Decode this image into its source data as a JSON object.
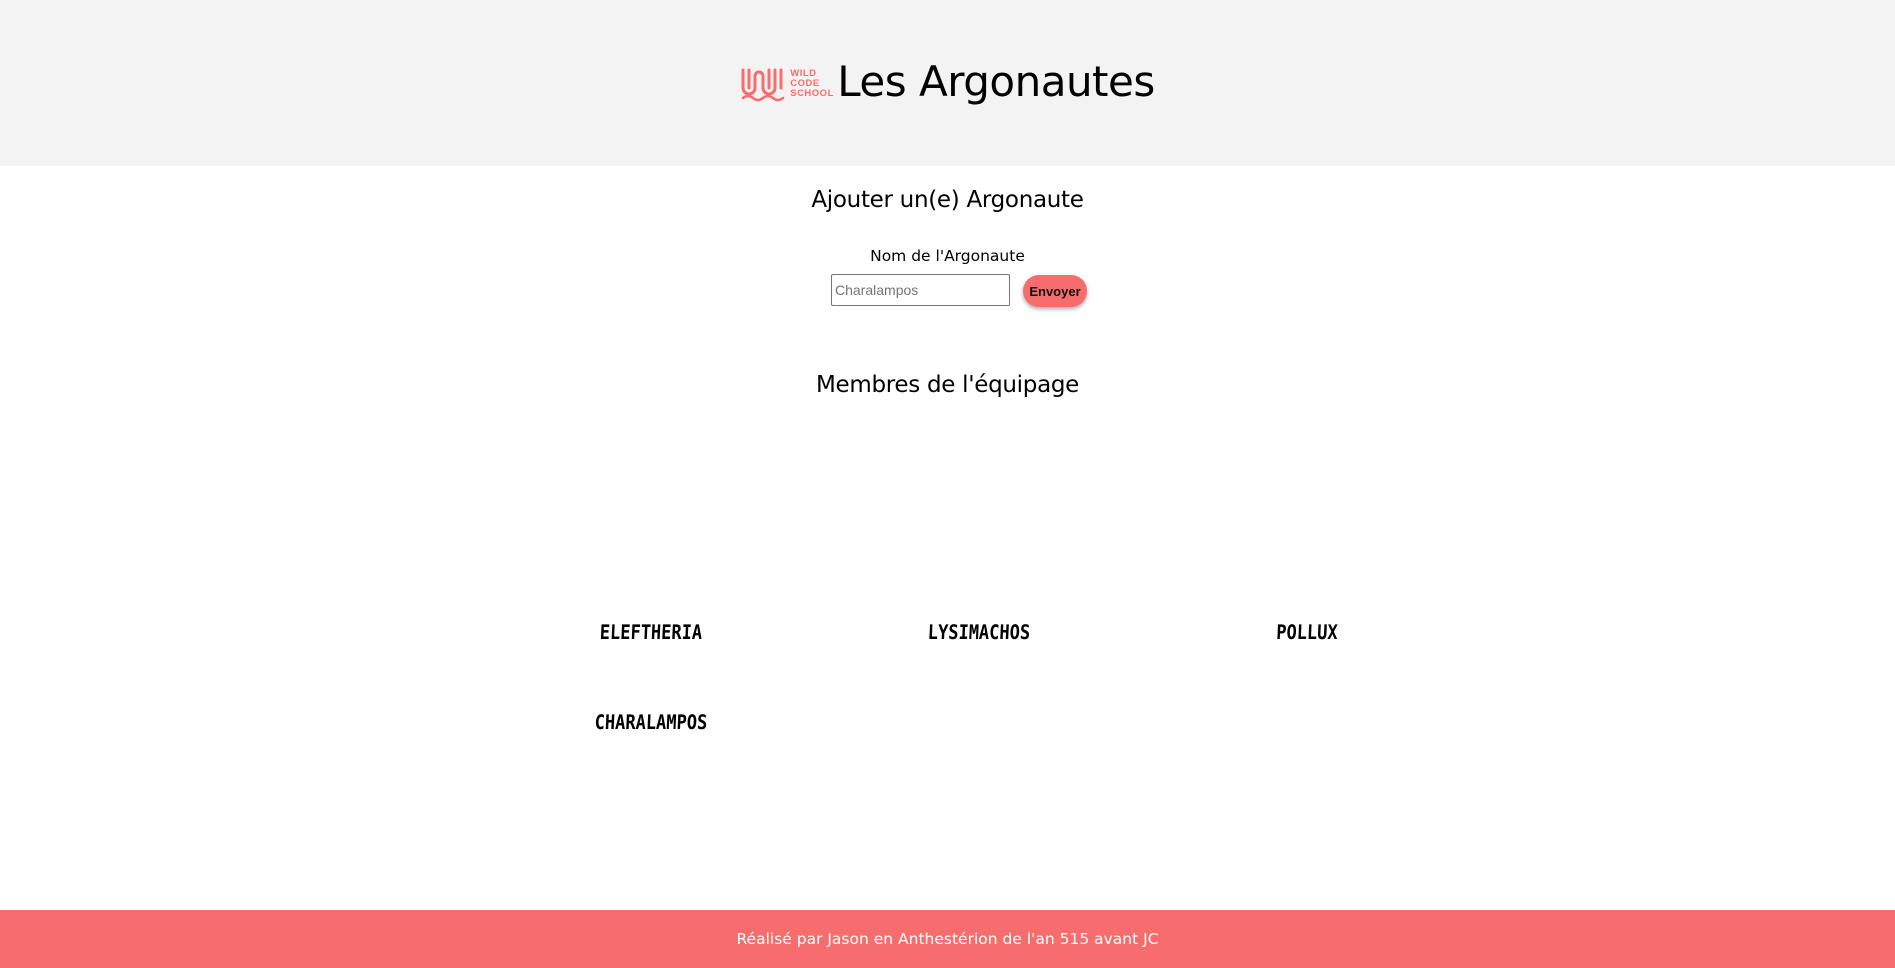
{
  "header": {
    "logo": {
      "icon": "wild-code-school-logo",
      "lines": [
        "WILD",
        "CODE",
        "SCHOOL"
      ],
      "color": "#f76c6c"
    },
    "title": "Les Argonautes"
  },
  "form": {
    "title": "Ajouter un(e) Argonaute",
    "label": "Nom de l'Argonaute",
    "input_placeholder": "Charalampos",
    "input_value": "",
    "submit_label": "Envoyer"
  },
  "crew": {
    "title": "Membres de l'équipage",
    "members": [
      "Eleftheria",
      "Lysimachos",
      "Pollux",
      "Charalampos"
    ]
  },
  "footer": {
    "text": "Réalisé par Jason en Anthestérion de l'an 515 avant JC"
  },
  "colors": {
    "accent": "#f76c6c",
    "header_bg": "#f3f3f3",
    "footer_text": "#ffffff"
  }
}
